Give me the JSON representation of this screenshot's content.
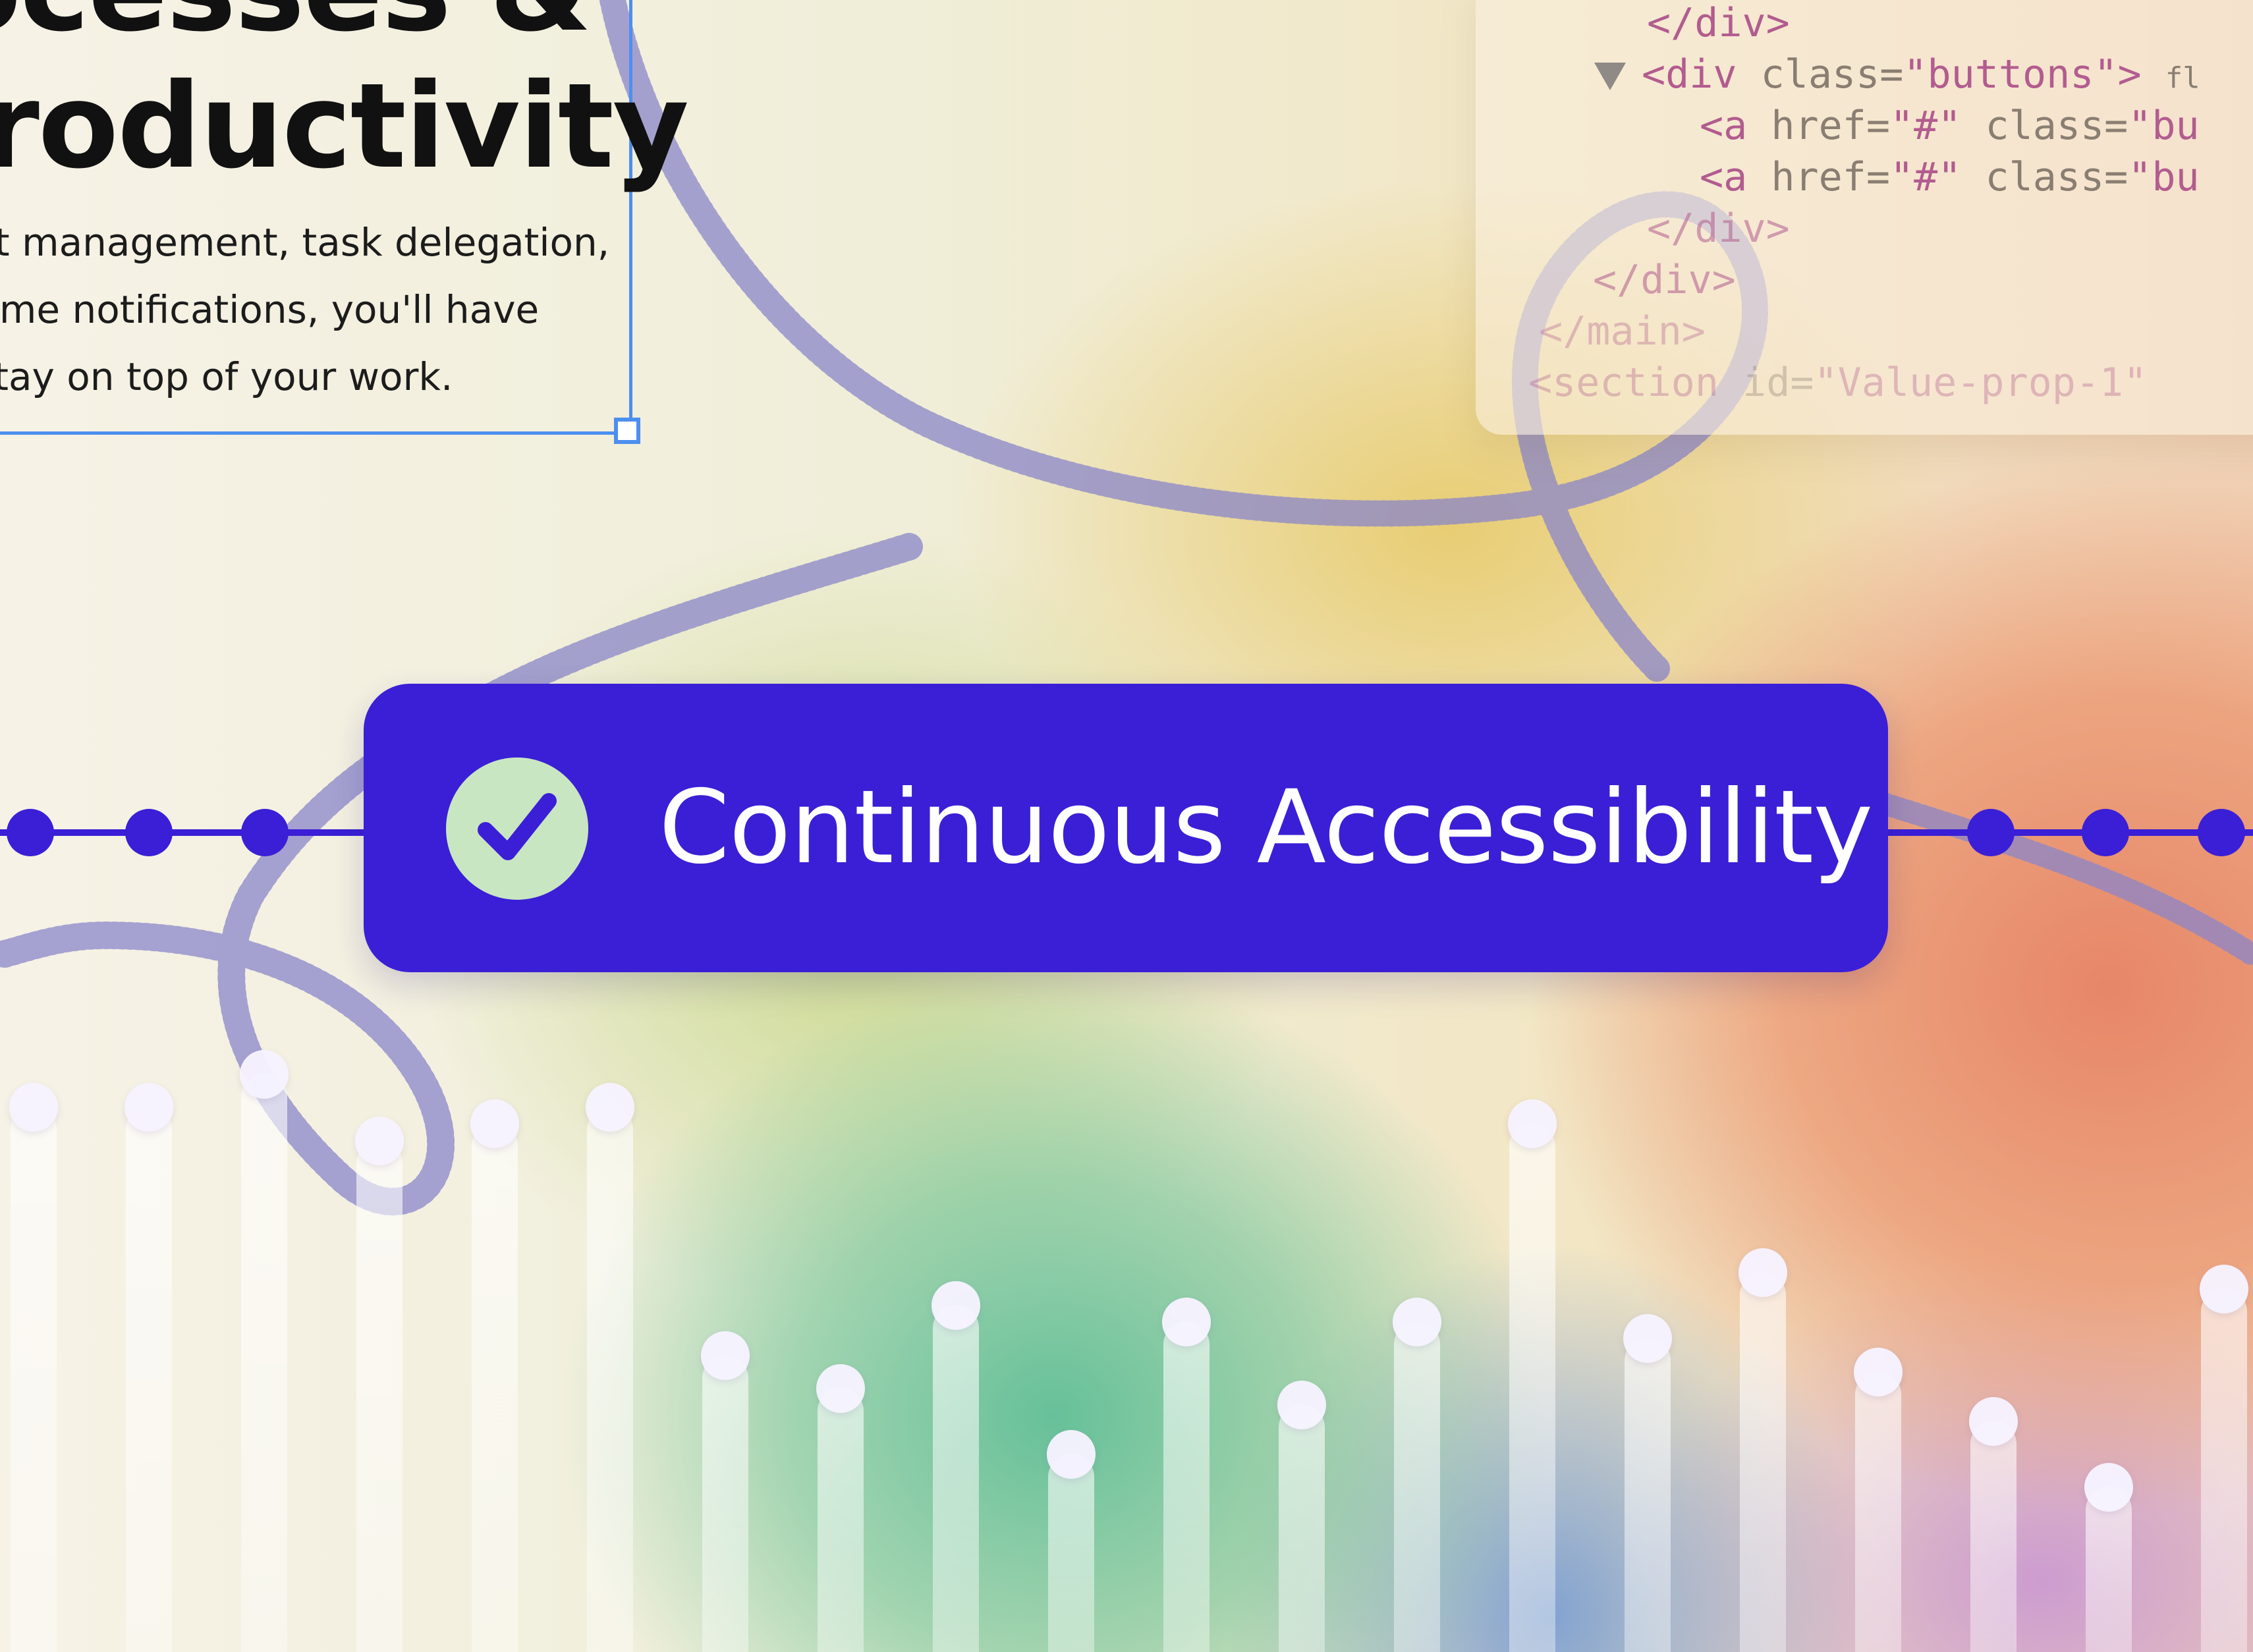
{
  "headline": {
    "line1": "ocesses &",
    "line2": "roductivity"
  },
  "paragraph": {
    "line1": "ct management, task delegation,",
    "line2": "time notifications, you'll have",
    "line3": "stay on top of your work."
  },
  "code_panel": {
    "line1": "</div>",
    "line2_tag": "<div",
    "line2_attr": "class=",
    "line2_str": "\"buttons\">",
    "line2_badge": "fl",
    "line3_tag": "<a",
    "line3_attr": "href=",
    "line3_str": "\"#\"",
    "line3_attr2": "class=",
    "line3_str2": "\"bu",
    "line4_tag": "<a",
    "line4_attr": "href=",
    "line4_str": "\"#\"",
    "line4_attr2": "class=",
    "line4_str2": "\"bu",
    "line5": "</div>",
    "line6": "</div>",
    "line7": "</main>",
    "line8_tag": "<section",
    "line8_attr": "id=",
    "line8_str": "\"Value-prop-1\""
  },
  "badge": {
    "label": "Continuous Accessibility",
    "icon": "checkmark-icon"
  },
  "bar_levels": [
    0.33,
    0.33,
    0.35,
    0.31,
    0.32,
    0.33,
    0.18,
    0.16,
    0.21,
    0.12,
    0.2,
    0.15,
    0.2,
    0.32,
    0.19,
    0.23,
    0.17,
    0.14,
    0.1,
    0.22
  ],
  "colors": {
    "accent": "#3a1fd6",
    "check_circle": "#c9e6c2",
    "selection": "#4d8fef"
  }
}
